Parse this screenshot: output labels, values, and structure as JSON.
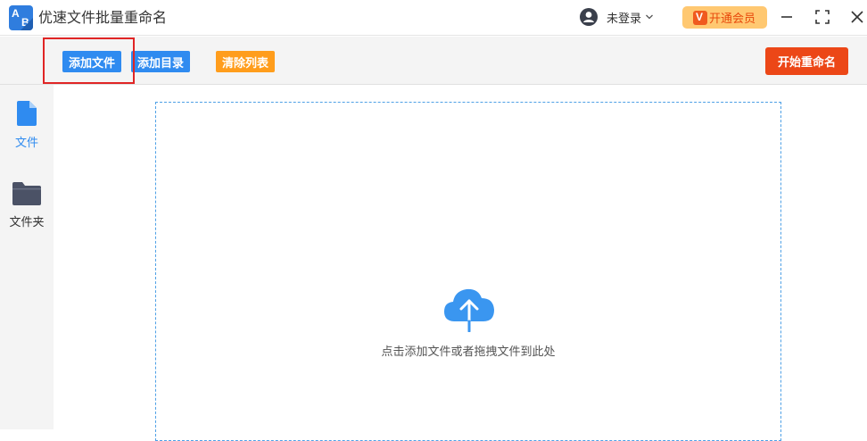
{
  "app": {
    "title": "优速文件批量重命名"
  },
  "user": {
    "login_label": "未登录"
  },
  "vip": {
    "label": "开通会员",
    "icon_letter": "V"
  },
  "toolbar": {
    "add_file": "添加文件",
    "add_folder": "添加目录",
    "clear_list": "清除列表",
    "start_rename": "开始重命名"
  },
  "sidebar": {
    "items": [
      {
        "label": "文件",
        "icon": "file-icon",
        "active": true
      },
      {
        "label": "文件夹",
        "icon": "folder-icon",
        "active": false
      }
    ]
  },
  "dropzone": {
    "hint": "点击添加文件或者拖拽文件到此处",
    "icon": "cloud-upload-icon"
  },
  "colors": {
    "accent_blue": "#2f8bf0",
    "orange": "#ff9d1c",
    "primary_red": "#ec4717",
    "highlight_red": "#e02525",
    "vip_bg": "#ffc871"
  }
}
